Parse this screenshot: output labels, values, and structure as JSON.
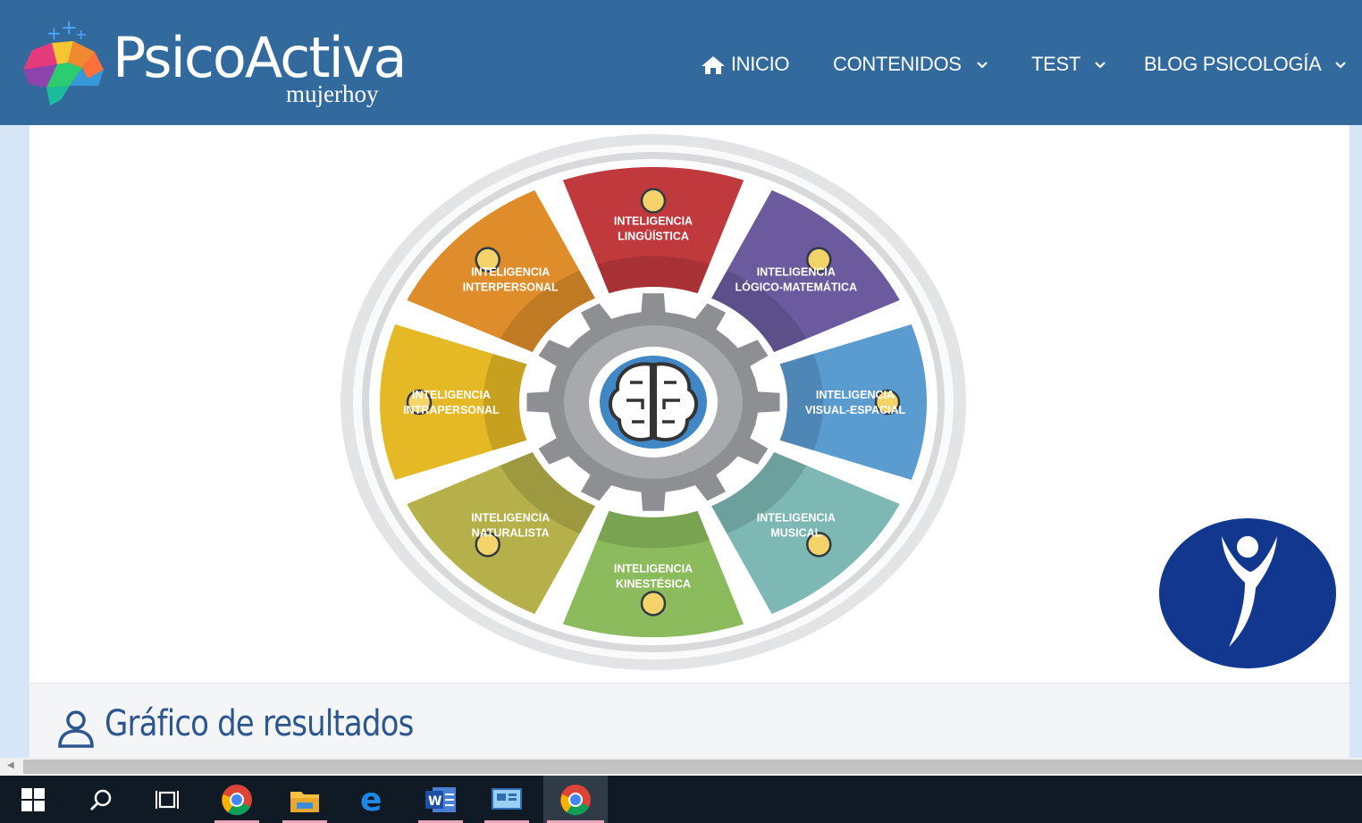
{
  "header": {
    "logo_title": "PsicoActiva",
    "logo_subtitle": "mujerhoy",
    "nav": [
      {
        "label": "INICIO",
        "icon": "home-icon"
      },
      {
        "label": "CONTENIDOS",
        "icon": "chevron-down-icon"
      },
      {
        "label": "TEST",
        "icon": "chevron-down-icon"
      },
      {
        "label": "BLOG PSICOLOGÍA",
        "icon": "chevron-down-icon"
      }
    ],
    "bg": "#336a9e"
  },
  "wheel": {
    "center_icon": "brain-icon",
    "segments": [
      {
        "line1": "INTELIGENCIA",
        "line2": "LINGÜÍSTICA",
        "color": "#c0393d",
        "icon": "book-icon"
      },
      {
        "line1": "INTELIGENCIA",
        "line2": "LÓGICO-MATEMÁTICA",
        "color": "#6b5b9e",
        "icon": "head-gear-icon"
      },
      {
        "line1": "INTELIGENCIA",
        "line2": "VISUAL-ESPACIAL",
        "color": "#5a9bd0",
        "icon": "cubes-icon"
      },
      {
        "line1": "INTELIGENCIA",
        "line2": "MUSICAL",
        "color": "#7db8b4",
        "icon": "headphones-icon"
      },
      {
        "line1": "INTELIGENCIA",
        "line2": "KINESTÉSICA",
        "color": "#8cbb5e",
        "icon": "person-icon"
      },
      {
        "line1": "INTELIGENCIA",
        "line2": "NATURALISTA",
        "color": "#b5b04a",
        "icon": "globe-icon"
      },
      {
        "line1": "INTELIGENCIA",
        "line2": "INTRAPERSONAL",
        "color": "#e5b825",
        "icon": "self-icon"
      },
      {
        "line1": "INTELIGENCIA",
        "line2": "INTERPERSONAL",
        "color": "#de8d2a",
        "icon": "people-icon"
      }
    ]
  },
  "results": {
    "title": "Gráfico de resultados",
    "icon": "user-outline-icon"
  },
  "taskbar": {
    "items": [
      "windows-start-icon",
      "search-icon",
      "task-view-icon",
      "chrome-icon",
      "file-explorer-icon",
      "edge-icon",
      "word-icon",
      "control-panel-icon",
      "chrome-icon"
    ]
  }
}
